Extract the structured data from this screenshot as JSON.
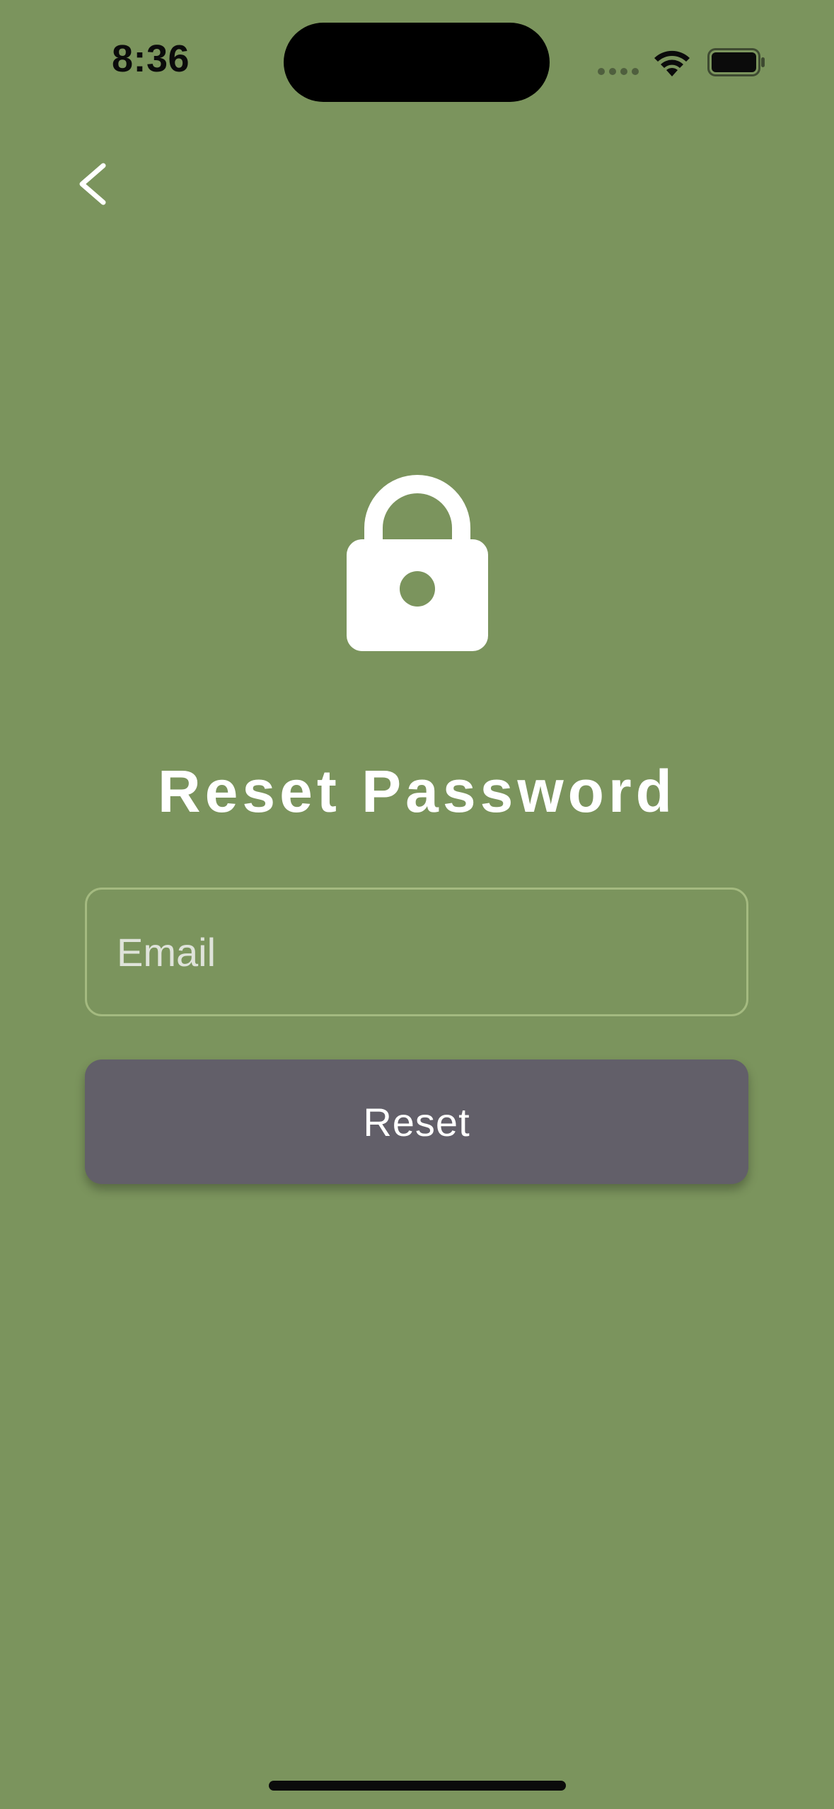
{
  "status_bar": {
    "time": "8:36"
  },
  "navigation": {
    "back_icon": "chevron-left-icon"
  },
  "header": {
    "icon": "lock-icon",
    "title": "Reset Password"
  },
  "form": {
    "email_placeholder": "Email",
    "email_value": "",
    "submit_label": "Reset"
  },
  "colors": {
    "background": "#7b945d",
    "button": "#625f69",
    "field_border": "#a4ba80",
    "text": "#ffffff"
  }
}
